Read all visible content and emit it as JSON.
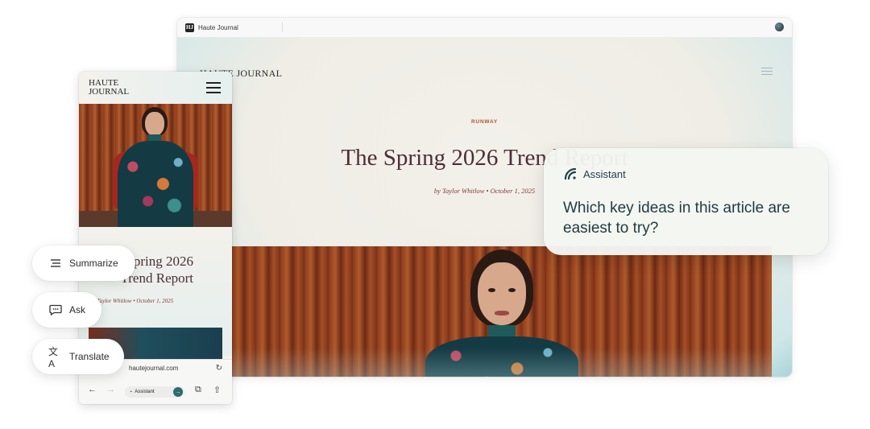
{
  "desktop": {
    "tab_title": "Haute Journal",
    "favicon": "HJ",
    "logo": "HAUTE JOURNAL",
    "kicker": "RUNWAY",
    "headline": "The Spring 2026 Trend Report",
    "byline": "by Taylor Whitlow • October 1, 2025"
  },
  "phone": {
    "logo_line1": "HAUTE",
    "logo_line2": "JOURNAL",
    "headline": "The Spring 2026 Trend Report",
    "byline": "by Taylor Whitlow • October 1, 2025",
    "url": "hautejournal.com",
    "assistant_label": "Assistant"
  },
  "chips": {
    "summarize": "Summarize",
    "ask": "Ask",
    "translate": "Translate"
  },
  "assistant": {
    "title": "Assistant",
    "question": "Which key ideas in this article are easiest to try?"
  },
  "colors": {
    "accent_teal": "#2d6a72",
    "headline": "#4b2f36",
    "kicker": "#b0542e"
  }
}
